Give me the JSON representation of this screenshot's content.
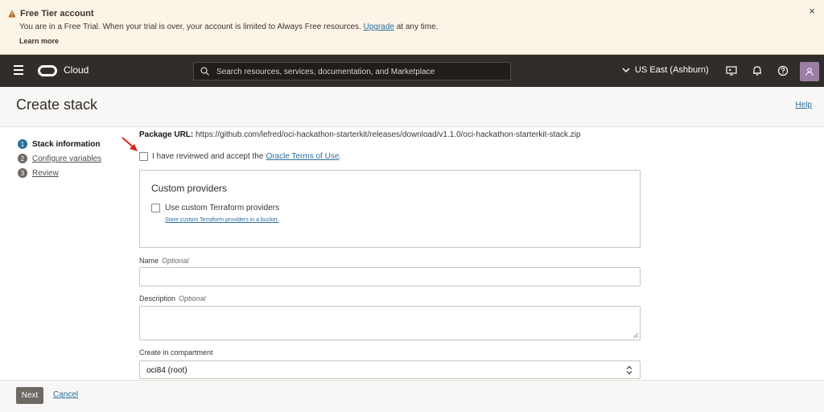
{
  "banner": {
    "title": "Free Tier account",
    "message_before": "You are in a Free Trial. When your trial is over, your account is limited to Always Free resources.",
    "upgrade_link": "Upgrade",
    "message_after": "at any time.",
    "learn_more": "Learn more",
    "close_icon": "×"
  },
  "topnav": {
    "brand": "Cloud",
    "search_placeholder": "Search resources, services, documentation, and Marketplace",
    "region": "US East (Ashburn)"
  },
  "header": {
    "title": "Create stack",
    "help": "Help"
  },
  "steps": [
    {
      "num": "1",
      "label": "Stack information"
    },
    {
      "num": "2",
      "label": "Configure variables"
    },
    {
      "num": "3",
      "label": "Review"
    }
  ],
  "form": {
    "package_label": "Package URL:",
    "package_url": "https://github.com/lefred/oci-hackathon-starterkit/releases/download/v1.1.0/oci-hackathon-starterkit-stack.zip",
    "accept_text": "I have reviewed and accept the",
    "accept_link": "Oracle Terms of Use",
    "accept_period": ".",
    "providers_title": "Custom providers",
    "providers_checkbox": "Use custom Terraform providers",
    "providers_link": "Store custom Terraform providers in a bucket.",
    "name_label": "Name",
    "name_optional": "Optional",
    "description_label": "Description",
    "description_optional": "Optional",
    "compartment_label": "Create in compartment",
    "compartment_value": "oci84 (root)"
  },
  "footer": {
    "next": "Next",
    "cancel": "Cancel"
  },
  "colors": {
    "accent": "#2b6e9e",
    "nav_bg": "#312d2a",
    "banner_bg": "#fcf4e6",
    "arrow": "#e0201b"
  }
}
